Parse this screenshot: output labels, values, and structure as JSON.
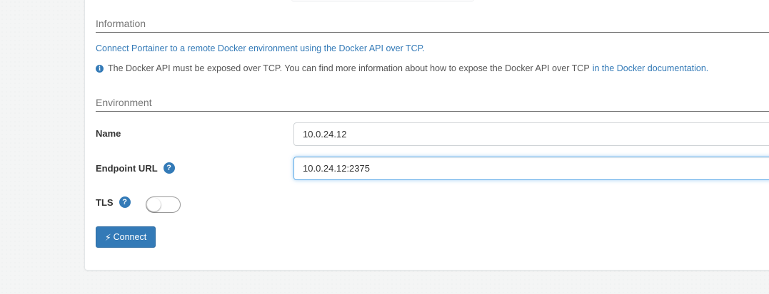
{
  "sections": {
    "information_title": "Information",
    "environment_title": "Environment"
  },
  "information": {
    "description": "Connect Portainer to a remote Docker environment using the Docker API over TCP.",
    "note_text": "The Docker API must be exposed over TCP. You can find more information about how to expose the Docker API over TCP",
    "note_link": "in the Docker documentation."
  },
  "form": {
    "name_label": "Name",
    "name_value": "10.0.24.12",
    "endpoint_url_label": "Endpoint URL",
    "endpoint_url_value": "10.0.24.12:2375",
    "tls_label": "TLS",
    "tls_enabled": false,
    "help_glyph": "?"
  },
  "actions": {
    "connect_label": "Connect",
    "connect_icon": "bolt-icon"
  },
  "icons": {
    "info_glyph": "i",
    "bolt_glyph": "⚡"
  },
  "colors": {
    "accent": "#337ab7",
    "focus_border": "#66afe9",
    "page_bg": "#f4f5f5"
  }
}
